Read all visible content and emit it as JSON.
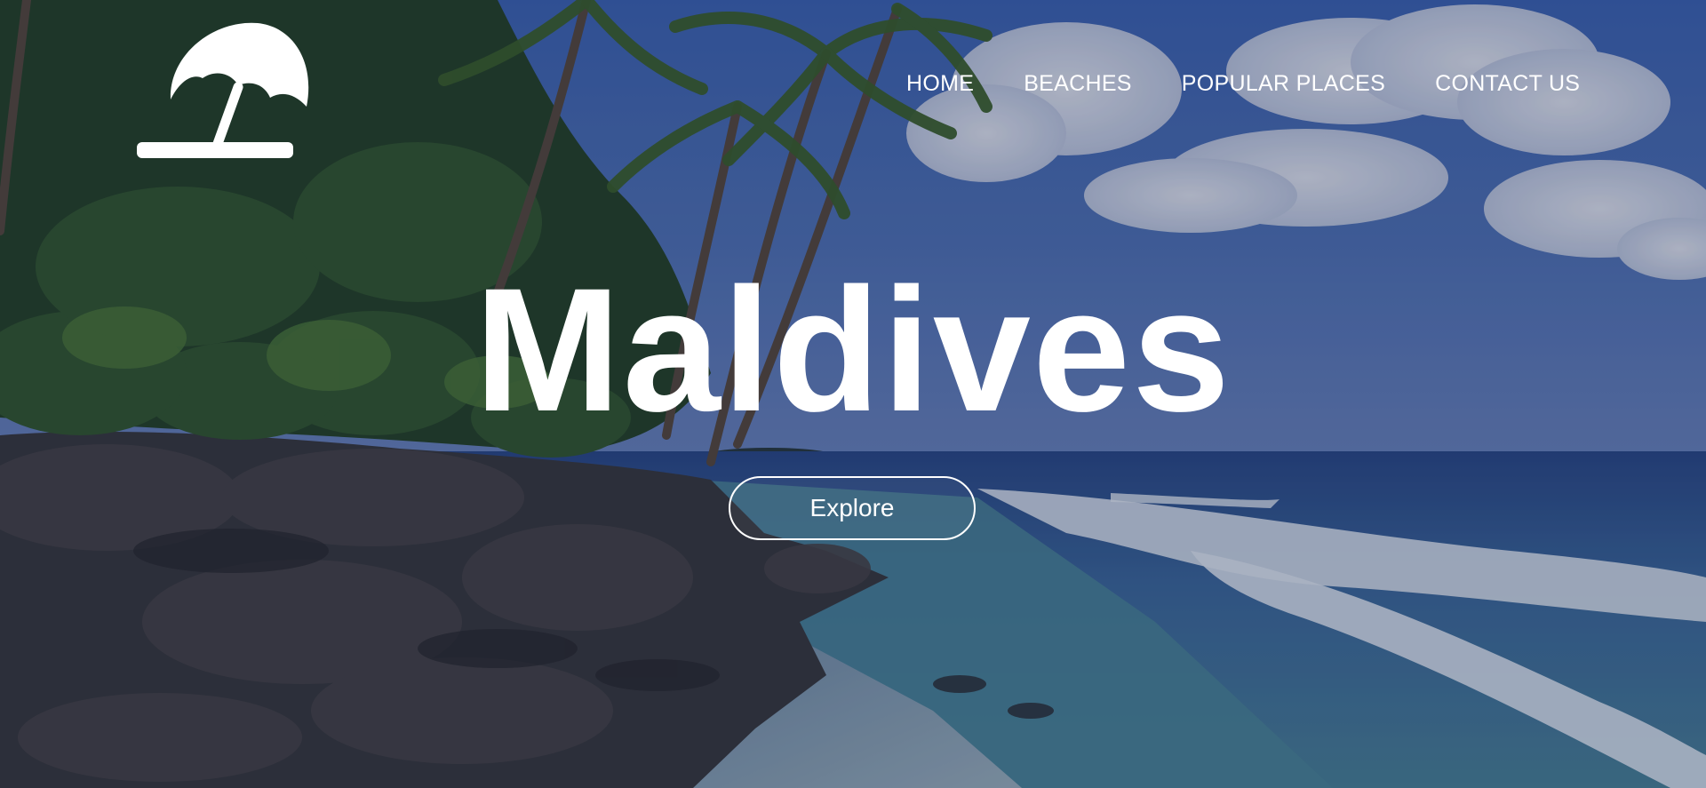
{
  "logo": {
    "icon": "beach-umbrella-icon"
  },
  "nav": {
    "items": [
      {
        "label": "HOME"
      },
      {
        "label": "BEACHES"
      },
      {
        "label": "POPULAR PLACES"
      },
      {
        "label": "CONTACT US"
      }
    ]
  },
  "hero": {
    "title": "Maldives",
    "cta_label": "Explore"
  },
  "colors": {
    "text": "#ffffff",
    "sky": "#4a6fb5",
    "ocean": "#2f4f86",
    "foam": "#e8eef5",
    "foliage": "#2d4a23",
    "rock": "#3e3b3a"
  }
}
